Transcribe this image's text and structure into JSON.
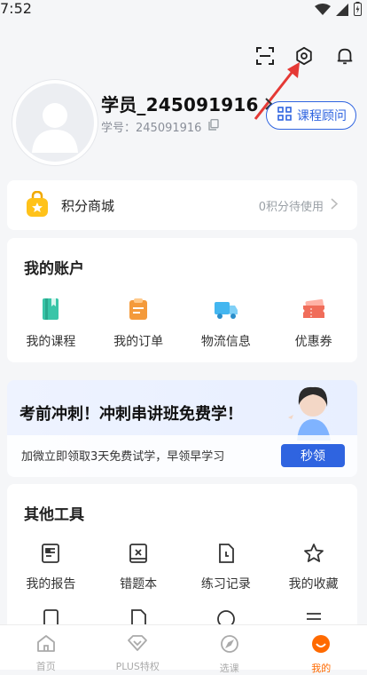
{
  "status": {
    "time": "7:52"
  },
  "header": {
    "username": "学员_245091916",
    "student_id": "学号：245091916",
    "advisor_label": "课程顾问"
  },
  "points": {
    "title": "积分商城",
    "right_text": "0积分待使用"
  },
  "account": {
    "title": "我的账户",
    "items": [
      {
        "label": "我的课程",
        "icon": "book-icon",
        "color": "#39c5a8"
      },
      {
        "label": "我的订单",
        "icon": "order-icon",
        "color": "#f49a3b"
      },
      {
        "label": "物流信息",
        "icon": "truck-icon",
        "color": "#43b6f0"
      },
      {
        "label": "优惠券",
        "icon": "coupon-icon",
        "color": "#f06d5a"
      }
    ]
  },
  "promo": {
    "title": "考前冲刺！冲刺串讲班免费学！",
    "subtitle": "加微立即领取3天免费试学，早领早学习",
    "button_label": "秒领"
  },
  "tools": {
    "title": "其他工具",
    "items": [
      {
        "label": "我的报告",
        "icon": "report-icon"
      },
      {
        "label": "错题本",
        "icon": "wrong-book-icon"
      },
      {
        "label": "练习记录",
        "icon": "practice-record-icon"
      },
      {
        "label": "我的收藏",
        "icon": "star-icon"
      }
    ]
  },
  "bottom_nav": {
    "items": [
      {
        "label": "首页",
        "icon": "home-icon"
      },
      {
        "label": "PLUS特权",
        "icon": "diamond-icon"
      },
      {
        "label": "选课",
        "icon": "compass-icon"
      },
      {
        "label": "我的",
        "icon": "profile-icon"
      }
    ],
    "active_index": 3,
    "accent": "#ff6a00"
  },
  "colors": {
    "brand_blue": "#2f64e0",
    "annotation_red": "#e53935"
  }
}
